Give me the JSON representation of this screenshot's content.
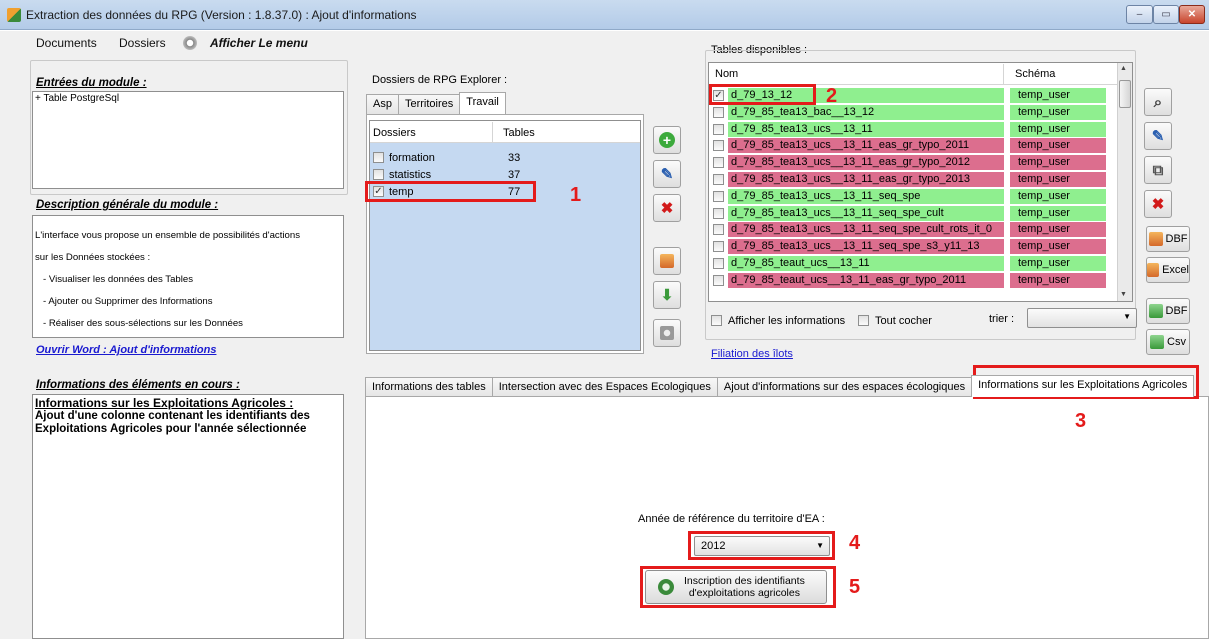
{
  "window": {
    "title": "Extraction des données du RPG (Version : 1.8.37.0) : Ajout d'informations",
    "min": "–",
    "max": "▭",
    "close": "✕"
  },
  "menu": {
    "documents": "Documents",
    "dossiers": "Dossiers",
    "afficher": "Afficher Le menu"
  },
  "left": {
    "entrees_title": "Entrées du module :",
    "entrees_item": "+ Table PostgreSql",
    "desc_title": "Description générale du module :",
    "desc_lines": [
      "L'interface vous propose un ensemble de possibilités d'actions",
      "sur les Données stockées :",
      "   - Visualiser les données des Tables",
      "   - Ajouter ou Supprimer des Informations",
      "   - Réaliser des sous-sélections sur les Données"
    ],
    "word_link": "Ouvrir Word : Ajout d'informations",
    "info_title": "Informations des éléments en cours :",
    "info_heading": "Informations sur les Exploitations Agricoles :",
    "info_text": "Ajout d'une colonne contenant les identifiants des Exploitations Agricoles pour l'année sélectionnée"
  },
  "dossiers": {
    "label": "Dossiers de RPG Explorer :",
    "tabs": [
      "Asp",
      "Territoires",
      "Travail"
    ],
    "col_dossiers": "Dossiers",
    "col_tables": "Tables",
    "rows": [
      {
        "name": "formation",
        "tables": "33",
        "checked": false
      },
      {
        "name": "statistics",
        "tables": "37",
        "checked": false
      },
      {
        "name": "temp",
        "tables": "77",
        "checked": true
      }
    ]
  },
  "tables": {
    "label": "Tables disponibles :",
    "col_nom": "Nom",
    "col_schema": "Schéma",
    "rows": [
      {
        "name": "d_79_13_12",
        "schema": "temp_user",
        "color": "#8fef8f",
        "checked": true
      },
      {
        "name": "d_79_85_tea13_bac__13_12",
        "schema": "temp_user",
        "color": "#8fef8f",
        "checked": false
      },
      {
        "name": "d_79_85_tea13_ucs__13_11",
        "schema": "temp_user",
        "color": "#8fef8f",
        "checked": false
      },
      {
        "name": "d_79_85_tea13_ucs__13_11_eas_gr_typo_2011",
        "schema": "temp_user",
        "color": "#dc6e8e",
        "checked": false
      },
      {
        "name": "d_79_85_tea13_ucs__13_11_eas_gr_typo_2012",
        "schema": "temp_user",
        "color": "#dc6e8e",
        "checked": false
      },
      {
        "name": "d_79_85_tea13_ucs__13_11_eas_gr_typo_2013",
        "schema": "temp_user",
        "color": "#dc6e8e",
        "checked": false
      },
      {
        "name": "d_79_85_tea13_ucs__13_11_seq_spe",
        "schema": "temp_user",
        "color": "#8fef8f",
        "checked": false
      },
      {
        "name": "d_79_85_tea13_ucs__13_11_seq_spe_cult",
        "schema": "temp_user",
        "color": "#8fef8f",
        "checked": false
      },
      {
        "name": "d_79_85_tea13_ucs__13_11_seq_spe_cult_rots_it_0",
        "schema": "temp_user",
        "color": "#dc6e8e",
        "checked": false
      },
      {
        "name": "d_79_85_tea13_ucs__13_11_seq_spe_s3_y11_13",
        "schema": "temp_user",
        "color": "#dc6e8e",
        "checked": false
      },
      {
        "name": "d_79_85_teaut_ucs__13_11",
        "schema": "temp_user",
        "color": "#8fef8f",
        "checked": false
      },
      {
        "name": "d_79_85_teaut_ucs__13_11_eas_gr_typo_2011",
        "schema": "temp_user",
        "color": "#dc6e8e",
        "checked": false
      }
    ],
    "afficher": "Afficher les informations",
    "tout_cocher": "Tout cocher",
    "trier": "trier :",
    "filiation": "Filiation des îlots"
  },
  "export": {
    "dbf1": "DBF",
    "excel": "Excel",
    "dbf2": "DBF",
    "csv": "Csv"
  },
  "bottom_tabs": [
    "Informations des tables",
    "Intersection avec des Espaces Ecologiques",
    "Ajout d'informations sur des espaces écologiques",
    "Informations sur les Exploitations Agricoles"
  ],
  "form": {
    "annee_label": "Année de référence du territoire d'EA :",
    "annee_value": "2012",
    "btn_line1": "Inscription des identifiants",
    "btn_line2": "d'exploitations agricoles"
  },
  "callouts": [
    "1",
    "2",
    "3",
    "4",
    "5"
  ],
  "colors": {
    "green_row": "#8fef8f",
    "red_row": "#dc6e8e",
    "callout": "#e41b1b",
    "panel_blue": "#c5d9f1"
  }
}
